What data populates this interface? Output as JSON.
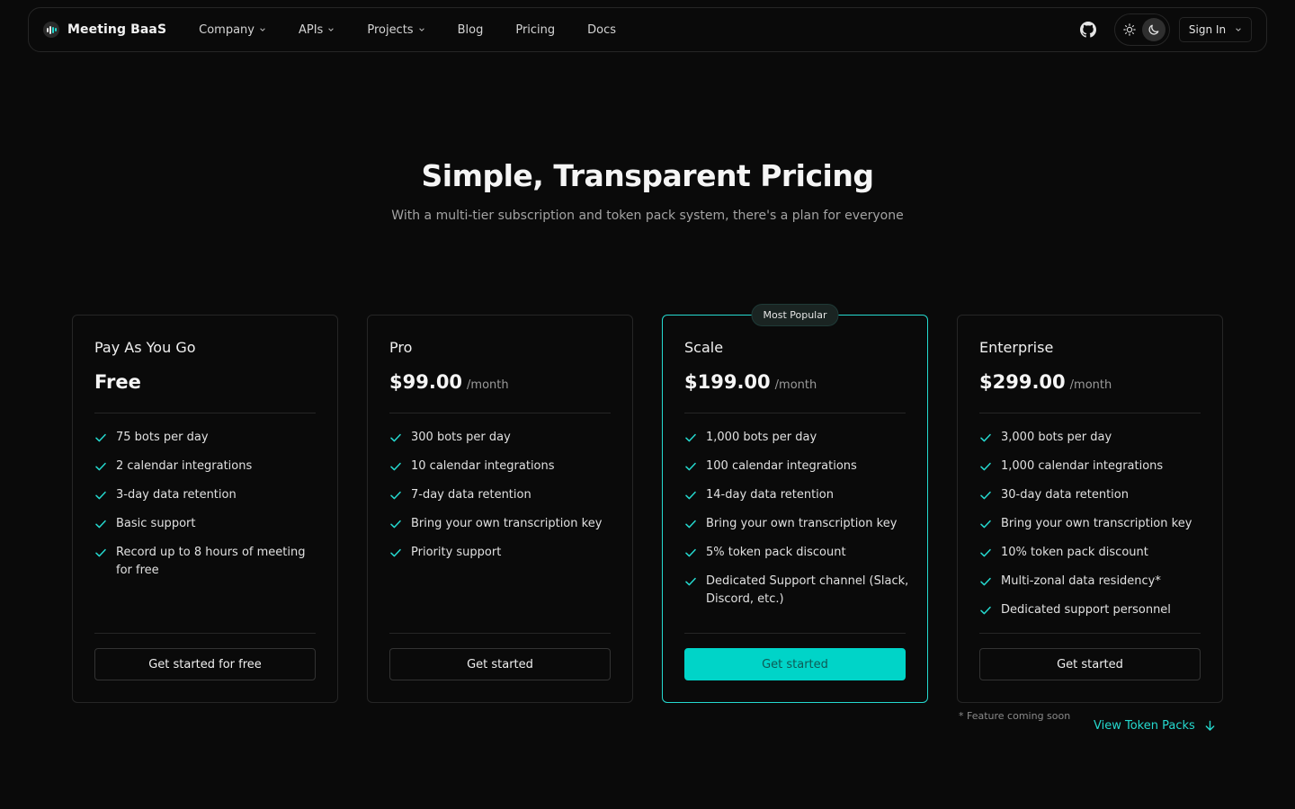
{
  "nav": {
    "brand": "Meeting BaaS",
    "links": [
      {
        "label": "Company",
        "dropdown": true
      },
      {
        "label": "APIs",
        "dropdown": true
      },
      {
        "label": "Projects",
        "dropdown": true
      },
      {
        "label": "Blog",
        "dropdown": false
      },
      {
        "label": "Pricing",
        "dropdown": false
      },
      {
        "label": "Docs",
        "dropdown": false
      }
    ],
    "sign_in": "Sign In",
    "icons": [
      "github-icon",
      "sun-icon",
      "moon-icon"
    ]
  },
  "hero": {
    "title": "Simple, Transparent Pricing",
    "subtitle": "With a multi-tier subscription and token pack system, there's a plan for everyone"
  },
  "plans": [
    {
      "name": "Pay As You Go",
      "price": "Free",
      "period": "",
      "features": [
        "75 bots per day",
        "2 calendar integrations",
        "3-day data retention",
        "Basic support",
        "Record up to 8 hours of meeting for free"
      ],
      "cta": "Get started for free"
    },
    {
      "name": "Pro",
      "price": "$99.00",
      "period": "/month",
      "features": [
        "300 bots per day",
        "10 calendar integrations",
        "7-day data retention",
        "Bring your own transcription key",
        "Priority support"
      ],
      "cta": "Get started"
    },
    {
      "name": "Scale",
      "price": "$199.00",
      "period": "/month",
      "badge": "Most Popular",
      "features": [
        "1,000 bots per day",
        "100 calendar integrations",
        "14-day data retention",
        "Bring your own transcription key",
        "5% token pack discount",
        "Dedicated Support channel (Slack, Discord, etc.)"
      ],
      "cta": "Get started"
    },
    {
      "name": "Enterprise",
      "price": "$299.00",
      "period": "/month",
      "features": [
        "3,000 bots per day",
        "1,000 calendar integrations",
        "30-day data retention",
        "Bring your own transcription key",
        "10% token pack discount",
        "Multi-zonal data residency*",
        "Dedicated support personnel"
      ],
      "cta": "Get started"
    }
  ],
  "footnote": "* Feature coming soon",
  "token_link": "View Token Packs",
  "colors": {
    "accent": "#00d4c8",
    "background": "#0a0a0a",
    "border": "#262626"
  }
}
